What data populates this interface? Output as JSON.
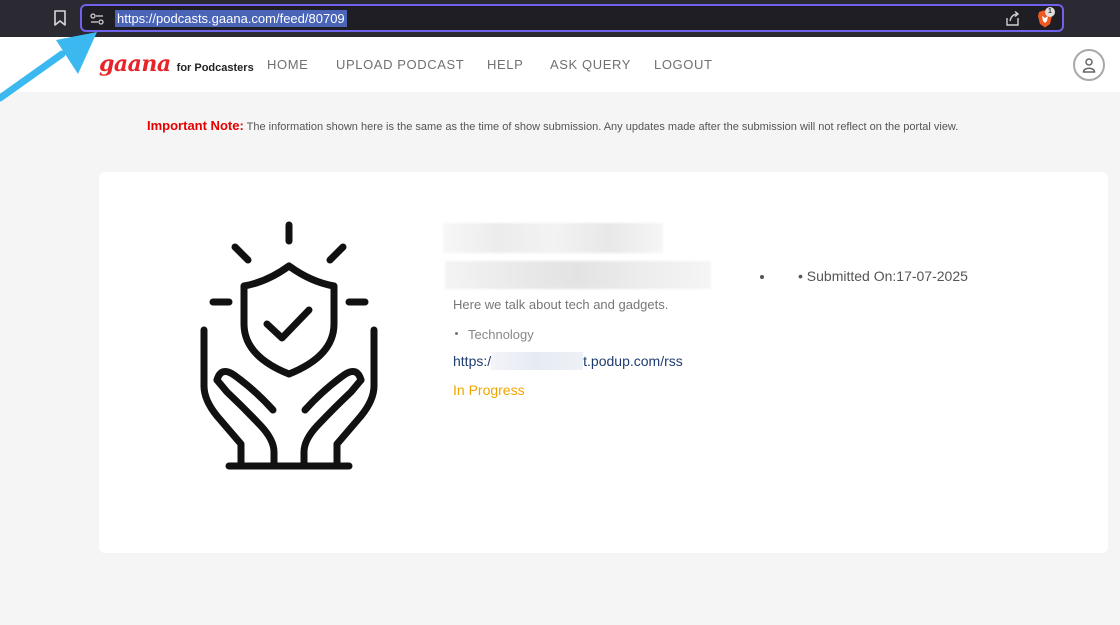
{
  "browser": {
    "url": "https://podcasts.gaana.com/feed/80709",
    "brave_badge_count": "1",
    "icons": {
      "bookmark": "bookmark-icon",
      "site_info": "site-info-icon",
      "share": "share-icon",
      "brave": "brave-shields-icon"
    },
    "accent": "#6f62e8"
  },
  "site": {
    "logo_main": "gaana",
    "logo_sub": "for Podcasters",
    "brand_color": "#e72429",
    "nav": [
      {
        "label": "HOME"
      },
      {
        "label": "UPLOAD PODCAST"
      },
      {
        "label": "HELP"
      },
      {
        "label": "ASK QUERY"
      },
      {
        "label": "LOGOUT"
      }
    ],
    "avatar_icon": "user-icon"
  },
  "notice": {
    "label": "Important Note:",
    "text": " The information shown here is the same as the time of show submission. Any updates made after the submission will not reflect on the portal view."
  },
  "podcast": {
    "hero_icon": "shield-check-hands-icon",
    "description": "Here we talk about tech and gadgets.",
    "category": "Technology",
    "rss_prefix": "https:/",
    "rss_suffix": "t.podup.com/rss",
    "status": "In Progress",
    "status_color": "#f0a500",
    "submitted_label": "• Submitted On:17-07-2025"
  }
}
